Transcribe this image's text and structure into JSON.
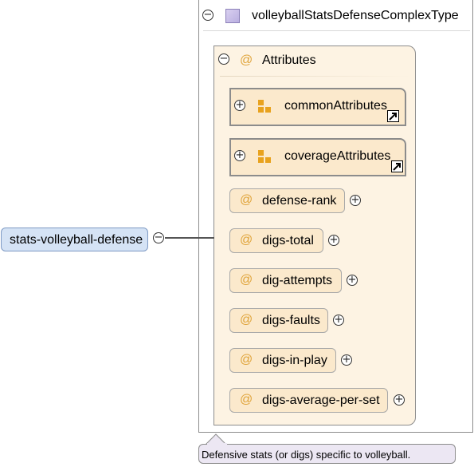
{
  "complex_type": {
    "name": "volleyballStatsDefenseComplexType",
    "collapse_symbol": "−"
  },
  "attributes_group": {
    "at_symbol": "@",
    "label": "Attributes",
    "collapse_symbol": "−"
  },
  "attribute_group_refs": [
    {
      "label": "commonAttributes",
      "expand_symbol": "+"
    },
    {
      "label": "coverageAttributes",
      "expand_symbol": "+"
    }
  ],
  "attributes": [
    {
      "at_symbol": "@",
      "label": "defense-rank",
      "expand_symbol": "+"
    },
    {
      "at_symbol": "@",
      "label": "digs-total",
      "expand_symbol": "+"
    },
    {
      "at_symbol": "@",
      "label": "dig-attempts",
      "expand_symbol": "+"
    },
    {
      "at_symbol": "@",
      "label": "digs-faults",
      "expand_symbol": "+"
    },
    {
      "at_symbol": "@",
      "label": "digs-in-play",
      "expand_symbol": "+"
    },
    {
      "at_symbol": "@",
      "label": "digs-average-per-set",
      "expand_symbol": "+"
    }
  ],
  "element": {
    "name": "stats-volleyball-defense",
    "collapse_symbol": "−"
  },
  "documentation": {
    "text": "Defensive stats (or digs) specific to volleyball."
  },
  "colors": {
    "attribute_fill": "#fbe9cc",
    "group_fill": "#fdf3e3",
    "element_fill": "#d5e3f5",
    "doc_fill": "#ece7f3",
    "at_symbol": "#e0a43a",
    "block_icon": "#e8a21e"
  }
}
